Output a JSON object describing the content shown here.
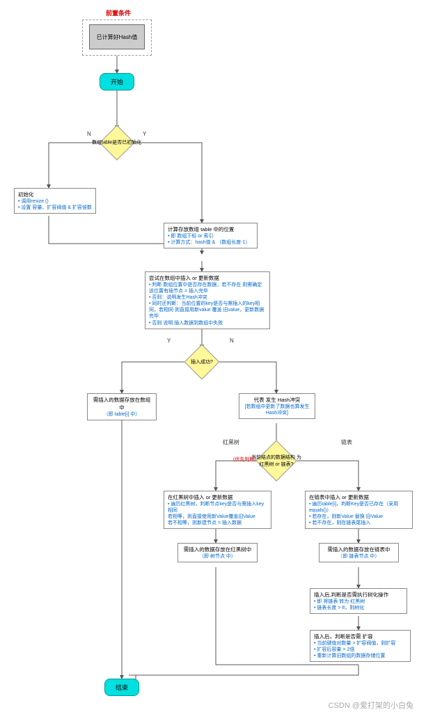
{
  "precondition": {
    "label": "前置条件",
    "box": "已计算好Hash值"
  },
  "start": "开始",
  "end": "结束",
  "decision_initialized": "数组table是否已初始化",
  "decision_init_Y": "Y",
  "decision_init_N": "N",
  "init_box": {
    "title": "初始化",
    "l1": "• 调用resize ()",
    "l2": "• 设置 容量、扩容阀值 & 扩容倍数"
  },
  "calc_pos": {
    "title": "计算存放数组 table 中的位置",
    "l1": "• 即 数组下标 or 索引",
    "l2": "• 计算方式：hash值 & （数组长度-1）"
  },
  "try_insert": {
    "title": "尝试在数组中插入 or 更新数据",
    "l1": "• 判断 数组位置中是否存在数据，若不存在 则需确定该位置有插节点 = 插入完毕",
    "l2": "• 否则：说明发生Hash冲突",
    "l3": "• 同时还判断：当前位置的key是否与需插入的key相同，若相同 则直接用新value 覆盖 旧value，更新数据完毕",
    "l4": "• 否则 说明 插入数据到数组中失败"
  },
  "decision_insert_ok": "插入成功?",
  "insert_ok_Y": "Y",
  "insert_ok_N": "N",
  "stored_in_array": {
    "title": "需插入的数据存放在数组中",
    "sub": "（即 table[i] 中）"
  },
  "hash_conflict": {
    "title": "代表 发生 Hash冲突",
    "sub": "[若数组中更新了数据也算发生Hash冲突]"
  },
  "decision_structure": {
    "line1": "当前结点的数据结构 为",
    "line2": "红黑树 or 链表?"
  },
  "structure_hint": "(优先判断)",
  "branch_rbtree": "红黑树",
  "branch_linked": "链表",
  "rbtree_insert": {
    "title": "在红黑树中插入 or 更新数据",
    "l1": "• 遍历红黑树，判断节点key是否与需插入key相同",
    "l2": "  若相等，则直接使用新Value覆盖旧Value",
    "l3": "  若不相等，则新建节点 = 插入数据"
  },
  "rbtree_stored": {
    "title": "需插入的数据存放在红黑树中",
    "sub": "（即 树节点 中）"
  },
  "linked_insert": {
    "title": "在链表中插入 or 更新数据",
    "l1": "• 遍历table[i]，判断Key是否已存在（采用equals()）",
    "l2": "• 若存在，则新Value 替换 旧Value",
    "l3": "• 若不存在，则在链表尾插入"
  },
  "linked_stored": {
    "title": "需插入的数据存放在链表中",
    "sub": "（即 链表节点 中）"
  },
  "treeify": {
    "title": "插入后,判断是否需执行树化操作",
    "l1": "• 即 将链表 转为 红黑树",
    "l2": "• 链表长度 > 8，则树化"
  },
  "resize_check": {
    "title": "插入后，判断是否需 扩容",
    "l1": "• 当前键值对数量 > 扩容阀值，则扩容",
    "l2": "• 扩容后容量 = 2倍",
    "l3": "• 重新计算旧数组的数据存储位置"
  },
  "watermark": "CSDN @爱打架的小白兔"
}
